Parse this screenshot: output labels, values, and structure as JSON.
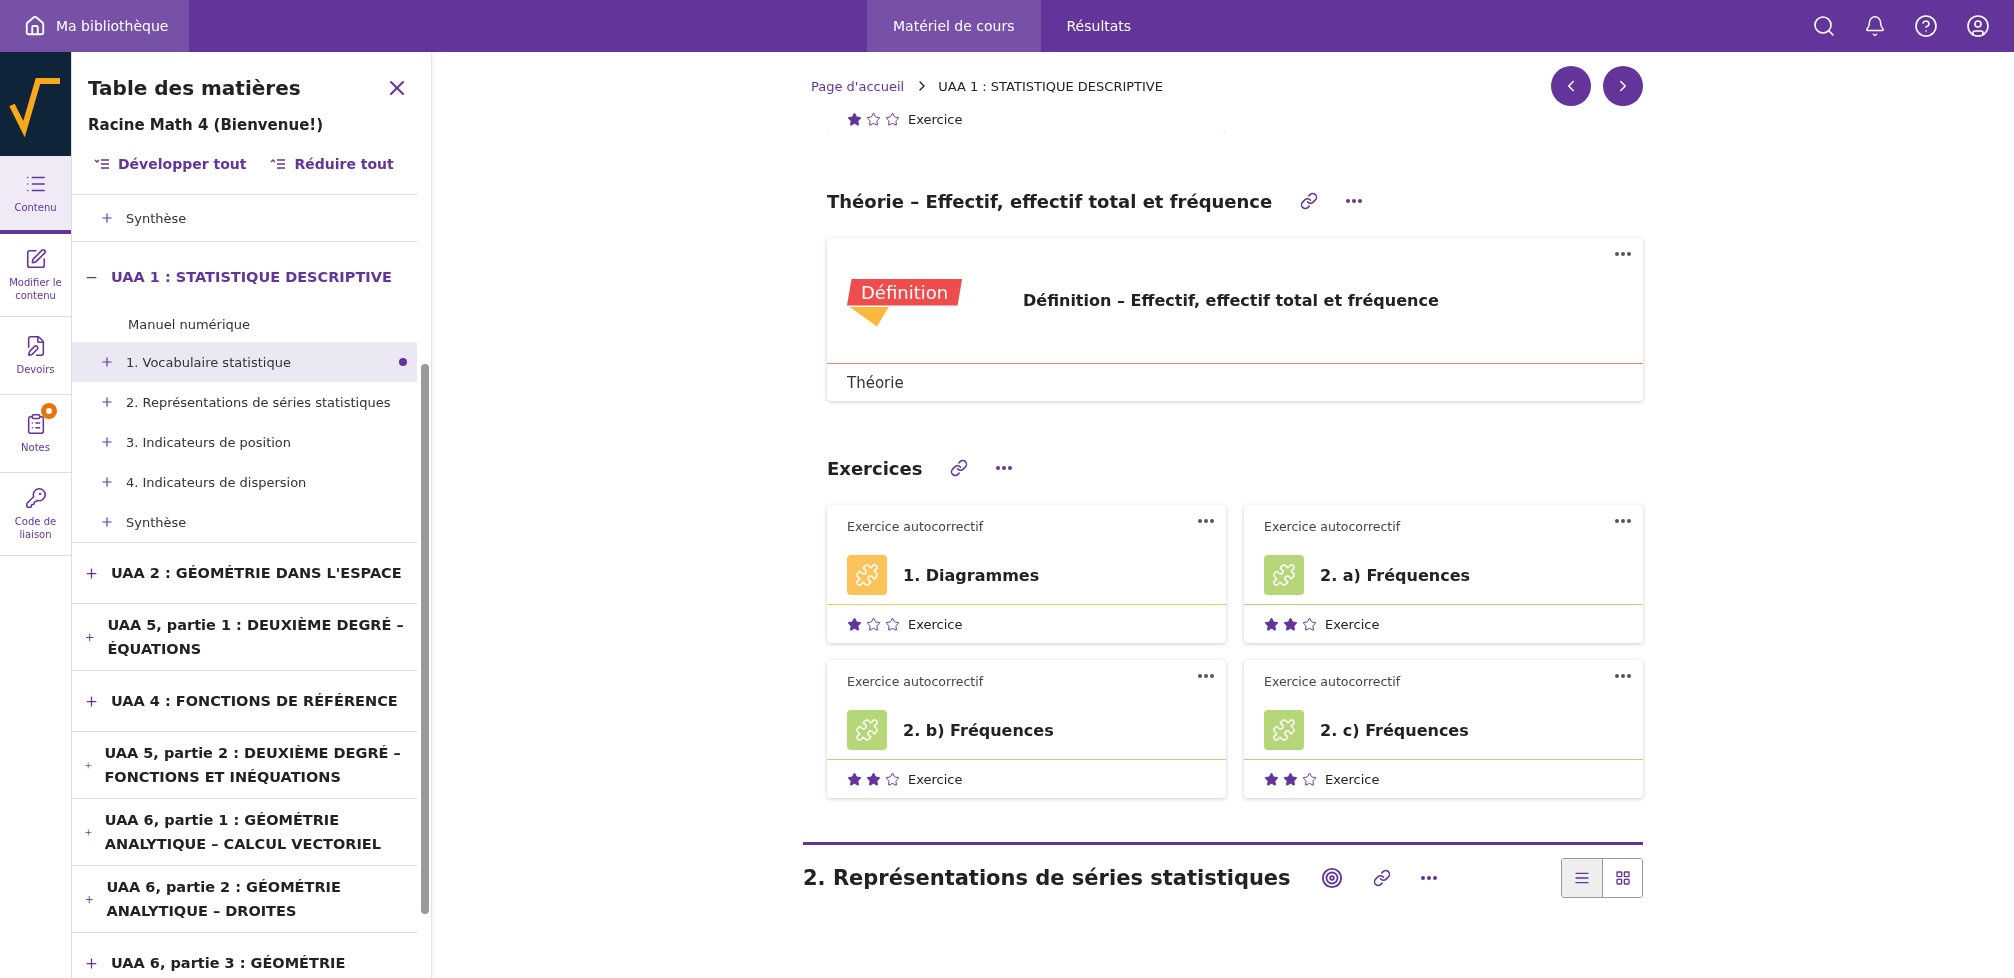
{
  "top_bar": {
    "home": "Ma bibliothèque",
    "tabs": [
      {
        "label": "Matériel de cours",
        "selected": true
      },
      {
        "label": "Résultats",
        "selected": false
      }
    ]
  },
  "rail": {
    "items": [
      {
        "kind": "content",
        "label": "Contenu",
        "selected": true,
        "badge": false
      },
      {
        "kind": "edit",
        "label": "Modifier le contenu",
        "selected": false,
        "badge": false
      },
      {
        "kind": "homework",
        "label": "Devoirs",
        "selected": false,
        "badge": false
      },
      {
        "kind": "notes",
        "label": "Notes",
        "selected": false,
        "badge": true
      },
      {
        "kind": "key",
        "label": "Code de liaison",
        "selected": false,
        "badge": false
      }
    ]
  },
  "toc": {
    "title": "Table des matières",
    "book": "Racine Math 4 (Bienvenue!)",
    "actions": [
      {
        "kind": "expand",
        "label": "Développer tout"
      },
      {
        "kind": "collapse",
        "label": "Réduire tout"
      }
    ],
    "items": [
      {
        "kind": "chapter",
        "label": "Synthèse",
        "expanded": false,
        "selected": false
      },
      {
        "kind": "unit",
        "label": "UAA 1 : STATISTIQUE DESCRIPTIVE",
        "expanded": true,
        "children": [
          {
            "kind": "link",
            "label": "Manuel numérique",
            "selected": false
          },
          {
            "kind": "chapter",
            "label": "1. Vocabulaire statistique",
            "expanded": false,
            "selected": true
          },
          {
            "kind": "chapter",
            "label": "2. Représentations de séries statistiques",
            "expanded": false,
            "selected": false
          },
          {
            "kind": "chapter",
            "label": "3. Indicateurs de position",
            "expanded": false,
            "selected": false
          },
          {
            "kind": "chapter",
            "label": "4. Indicateurs de dispersion",
            "expanded": false,
            "selected": false
          },
          {
            "kind": "chapter",
            "label": "Synthèse",
            "expanded": false,
            "selected": false
          }
        ]
      },
      {
        "kind": "unit",
        "label": "UAA 2 : GÉOMÉTRIE DANS L'ESPACE",
        "expanded": false
      },
      {
        "kind": "unit",
        "label": "UAA 5, partie 1 : DEUXIÈME DEGRÉ – ÉQUATIONS",
        "expanded": false
      },
      {
        "kind": "unit",
        "label": "UAA 4 : FONCTIONS DE RÉFÉRENCE",
        "expanded": false
      },
      {
        "kind": "unit",
        "label": "UAA 5, partie 2 : DEUXIÈME DEGRÉ – FONCTIONS ET INÉQUATIONS",
        "expanded": false
      },
      {
        "kind": "unit",
        "label": "UAA 6, partie 1 : GÉOMÉTRIE ANALYTIQUE – CALCUL VECTORIEL",
        "expanded": false
      },
      {
        "kind": "unit",
        "label": "UAA 6, partie 2 : GÉOMÉTRIE ANALYTIQUE – DROITES",
        "expanded": false
      },
      {
        "kind": "unit",
        "label": "UAA 6, partie 3 : GÉOMÉTRIE",
        "expanded": false
      }
    ]
  },
  "breadcrumb": [
    "Page d'accueil",
    "UAA 1 : STATISTIQUE DESCRIPTIVE"
  ],
  "previous_card": {
    "stars": 1,
    "footer": "Exercice"
  },
  "theory": {
    "title": "Théorie – Effectif, effectif total et fréquence",
    "card": {
      "badge": "Définition",
      "title": "Définition – Effectif, effectif total et fréquence",
      "footer": "Théorie"
    }
  },
  "exercises": {
    "title": "Exercices",
    "cards": [
      {
        "type": "Exercice autocorrectif",
        "title": "1. Diagrammes",
        "stars": 1,
        "footer": "Exercice",
        "color": "#fcc35b"
      },
      {
        "type": "Exercice autocorrectif",
        "title": "2. a) Fréquences",
        "stars": 2,
        "footer": "Exercice",
        "color": "#b5d77a"
      },
      {
        "type": "Exercice autocorrectif",
        "title": "2. b) Fréquences",
        "stars": 2,
        "footer": "Exercice",
        "color": "#b5d77a"
      },
      {
        "type": "Exercice autocorrectif",
        "title": "2. c) Fréquences",
        "stars": 2,
        "footer": "Exercice",
        "color": "#b5d77a"
      }
    ]
  },
  "next_section": {
    "title": "2. Représentations de séries statistiques",
    "views": [
      {
        "kind": "list",
        "selected": true
      },
      {
        "kind": "grid",
        "selected": false
      }
    ]
  }
}
